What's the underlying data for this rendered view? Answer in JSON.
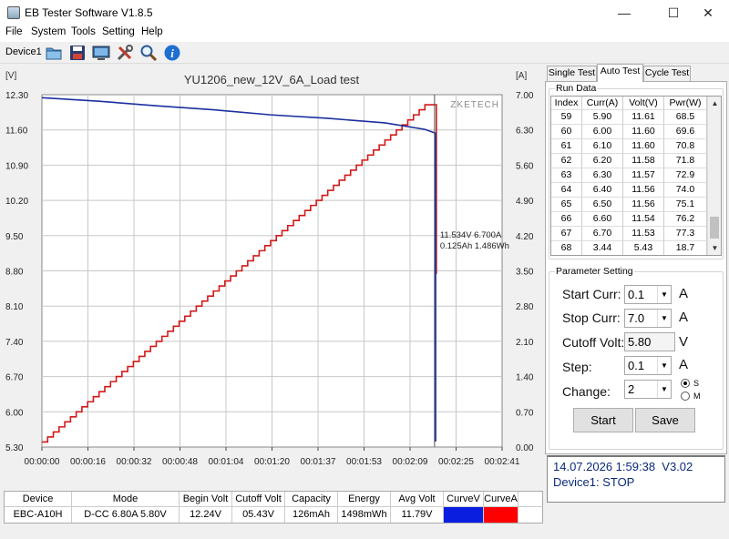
{
  "window": {
    "title": "EB Tester Software V1.8.5",
    "min": "—",
    "max": "☐",
    "close": "✕"
  },
  "menu": [
    "File",
    "System",
    "Tools",
    "Setting",
    "Help"
  ],
  "toolbar": {
    "device_label": "Device1",
    "icons": [
      "open-folder-icon",
      "save-icon",
      "monitor-icon",
      "tools-icon",
      "zoom-icon",
      "info-icon"
    ]
  },
  "chart": {
    "unit_left": "[V]",
    "unit_right": "[A]",
    "watermark": "ZKETECH",
    "cursor_readout": [
      "11.534V  6.700A",
      "0.125Ah 1.486Wh"
    ],
    "colors": {
      "volt": "#1b2fa0",
      "curr": "#d11a1a",
      "grid": "#c8c8c8",
      "cursor": "#555555"
    }
  },
  "chart_data": {
    "type": "line",
    "title": "YU1206_new_12V_6A_Load test",
    "ylabel_left": "[V]",
    "ylabel_right": "[A]",
    "x_ticks": [
      "00:00:00",
      "00:00:16",
      "00:00:32",
      "00:00:48",
      "00:01:04",
      "00:01:20",
      "00:01:37",
      "00:01:53",
      "00:02:09",
      "00:02:25",
      "00:02:41"
    ],
    "y_left_ticks": [
      "12.30",
      "11.60",
      "10.90",
      "10.20",
      "9.50",
      "8.80",
      "8.10",
      "7.40",
      "6.70",
      "6.00",
      "5.30"
    ],
    "y_right_ticks": [
      "7.00",
      "6.30",
      "5.60",
      "4.90",
      "4.20",
      "3.50",
      "2.80",
      "2.10",
      "1.40",
      "0.70",
      "0.00"
    ],
    "x_range_s": [
      0,
      161
    ],
    "ylim_left": [
      5.3,
      12.3
    ],
    "ylim_right": [
      0,
      7.0
    ],
    "grid": true,
    "series": [
      {
        "name": "CurveV",
        "axis": "left",
        "x": [
          0,
          20,
          40,
          60,
          80,
          100,
          120,
          134,
          138
        ],
        "values": [
          12.24,
          12.17,
          12.08,
          12.0,
          11.9,
          11.83,
          11.74,
          11.61,
          11.53
        ]
      },
      {
        "name": "CurveA",
        "axis": "right",
        "step": true,
        "x_start": 0,
        "x_step": 2,
        "start": 0.1,
        "increment": 0.1,
        "end": 6.8
      }
    ],
    "cutoff_s": 138
  },
  "bottom_table": {
    "headers": [
      "Device",
      "Mode",
      "Begin Volt",
      "Cutoff Volt",
      "Capacity",
      "Energy",
      "Avg Volt",
      "CurveV",
      "CurveA"
    ],
    "row": [
      "EBC-A10H",
      "D-CC  6.80A  5.80V",
      "12.24V",
      "05.43V",
      "126mAh",
      "1498mWh",
      "11.79V",
      "",
      ""
    ],
    "curve_colors": [
      "#0a1ee0",
      "#ff0000"
    ]
  },
  "tabs": [
    "Single Test",
    "Auto Test",
    "Cycle Test"
  ],
  "run_data": {
    "group_label": "Run Data",
    "headers": [
      "Index",
      "Curr(A)",
      "Volt(V)",
      "Pwr(W)"
    ],
    "rows": [
      [
        "59",
        "5.90",
        "11.61",
        "68.5"
      ],
      [
        "60",
        "6.00",
        "11.60",
        "69.6"
      ],
      [
        "61",
        "6.10",
        "11.60",
        "70.8"
      ],
      [
        "62",
        "6.20",
        "11.58",
        "71.8"
      ],
      [
        "63",
        "6.30",
        "11.57",
        "72.9"
      ],
      [
        "64",
        "6.40",
        "11.56",
        "74.0"
      ],
      [
        "65",
        "6.50",
        "11.56",
        "75.1"
      ],
      [
        "66",
        "6.60",
        "11.54",
        "76.2"
      ],
      [
        "67",
        "6.70",
        "11.53",
        "77.3"
      ],
      [
        "68",
        "3.44",
        "5.43",
        "18.7"
      ]
    ]
  },
  "params": {
    "group_label": "Parameter Setting",
    "start_curr": {
      "label": "Start Curr:",
      "value": "0.1",
      "unit": "A"
    },
    "stop_curr": {
      "label": "Stop Curr:",
      "value": "7.0",
      "unit": "A"
    },
    "cutoff_volt": {
      "label": "Cutoff Volt:",
      "value": "5.80",
      "unit": "V"
    },
    "step": {
      "label": "Step:",
      "value": "0.1",
      "unit": "A"
    },
    "change": {
      "label": "Change:",
      "value": "2",
      "opt_s": "S",
      "opt_m": "M"
    },
    "start_button": "Start",
    "save_button": "Save"
  },
  "status": {
    "datetime": "14.07.2026 1:59:38",
    "version": "V3.02",
    "state": "Device1: STOP"
  }
}
